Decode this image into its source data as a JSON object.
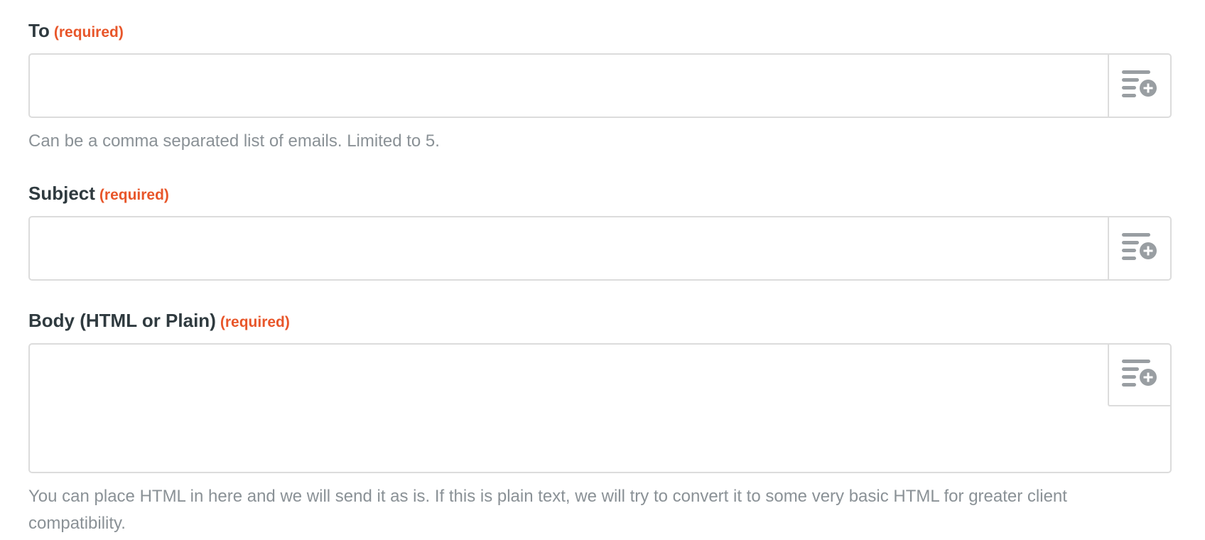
{
  "fields": {
    "to": {
      "label": "To",
      "required": "(required)",
      "value": "",
      "help": "Can be a comma separated list of emails. Limited to 5.",
      "insert_icon": "insert-field-icon"
    },
    "subject": {
      "label": "Subject",
      "required": "(required)",
      "value": "",
      "insert_icon": "insert-field-icon"
    },
    "body": {
      "label": "Body (HTML or Plain)",
      "required": "(required)",
      "value": "",
      "help": "You can place HTML in here and we will send it as is. If this is plain text, we will try to convert it to some very basic HTML for greater client compatibility.",
      "insert_icon": "insert-field-icon"
    }
  },
  "colors": {
    "required": "#e8562a",
    "label": "#2f3a3f",
    "help": "#8a9196",
    "border": "#dcdcdc",
    "icon": "#999ea2"
  }
}
